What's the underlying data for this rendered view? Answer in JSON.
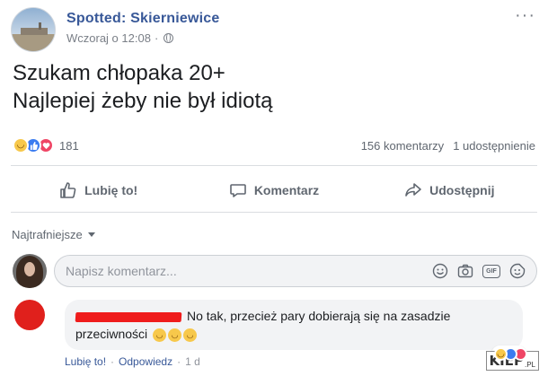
{
  "post": {
    "page_name": "Spotted: Skierniewice",
    "timestamp": "Wczoraj o 12:08",
    "separator": "·",
    "more_label": "···",
    "text_line1": "Szukam chłopaka 20+",
    "text_line2": "Najlepiej żeby nie był idiotą",
    "reaction_count": "181",
    "comments_count": "156 komentarzy",
    "shares_count": "1 udostępnienie",
    "reaction_icons": [
      "haha-icon",
      "like-icon",
      "love-icon"
    ]
  },
  "actions": {
    "like_label": "Lubię to!",
    "comment_label": "Komentarz",
    "share_label": "Udostępnij"
  },
  "comments_section": {
    "sort_label": "Najtrafniejsze",
    "input_placeholder": "Napisz komentarz...",
    "input_icons": [
      "emoji-icon",
      "camera-icon",
      "gif-icon",
      "sticker-icon"
    ],
    "gif_text": "GIF"
  },
  "comment": {
    "text": "No tak, przecież pary dobierają się na zasadzie przeciwności",
    "like_link": "Lubię to!",
    "reply_link": "Odpowiedz",
    "time": "1 d",
    "separator": "·"
  },
  "watermark": {
    "brand": "KIEP",
    "suffix": ".PL"
  },
  "colors": {
    "link_blue": "#385898",
    "redaction_red": "#ef1c1c",
    "bubble_bg": "#f2f3f5"
  }
}
